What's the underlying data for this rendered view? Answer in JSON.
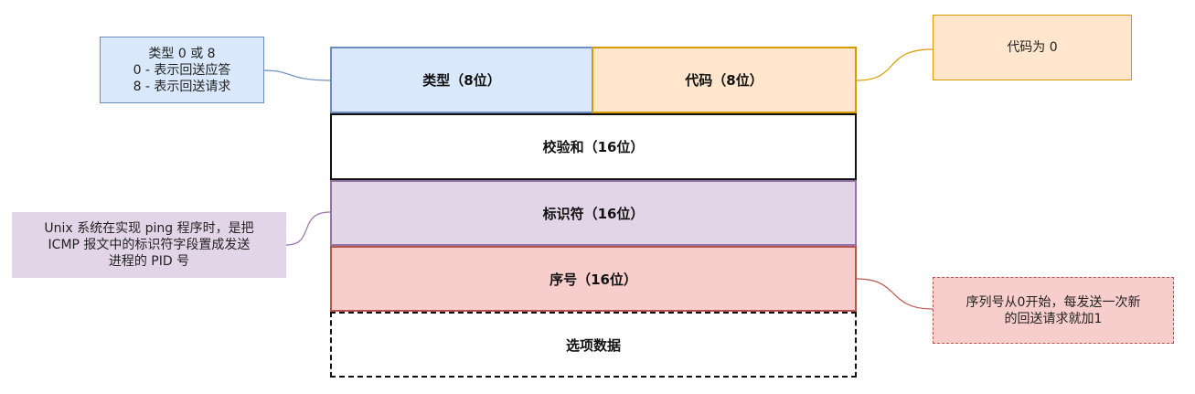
{
  "packet": {
    "type_field": "类型（8位）",
    "code_field": "代码（8位）",
    "checksum_field": "校验和（16位）",
    "identifier_field": "标识符（16位）",
    "sequence_field": "序号（16位）",
    "options_field": "选项数据"
  },
  "notes": {
    "type_note": [
      "类型 0 或 8",
      "0 - 表示回送应答",
      "8 - 表示回送请求"
    ],
    "code_note": "代码为 0",
    "identifier_note": [
      "Unix 系统在实现 ping 程序时，是把",
      "ICMP 报文中的标识符字段置成发送",
      "进程的 PID 号"
    ],
    "sequence_note": [
      "序列号从0开始，每发送一次新",
      "的回送请求就加1"
    ]
  },
  "colors": {
    "type_fill": "#dae8fc",
    "type_stroke": "#6c8ebf",
    "code_fill": "#ffe6cc",
    "code_stroke": "#d79b00",
    "ident_fill": "#e1d5e7",
    "ident_stroke": "#9673a6",
    "seq_fill": "#f8cecc",
    "seq_stroke": "#b85450",
    "black": "#111111"
  }
}
